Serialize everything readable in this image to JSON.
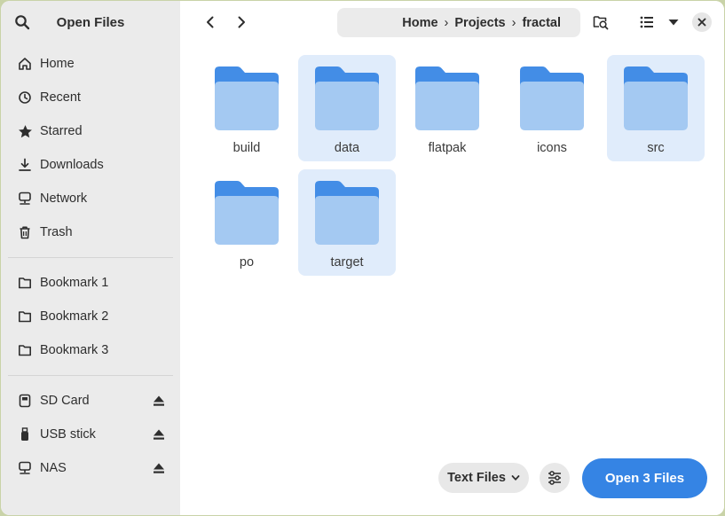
{
  "sidebar": {
    "title": "Open Files",
    "places": [
      {
        "label": "Home",
        "icon": "home-icon"
      },
      {
        "label": "Recent",
        "icon": "clock-icon"
      },
      {
        "label": "Starred",
        "icon": "star-icon"
      },
      {
        "label": "Downloads",
        "icon": "download-icon"
      },
      {
        "label": "Network",
        "icon": "network-icon"
      },
      {
        "label": "Trash",
        "icon": "trash-icon"
      }
    ],
    "bookmarks": [
      {
        "label": "Bookmark 1",
        "icon": "folder-icon"
      },
      {
        "label": "Bookmark 2",
        "icon": "folder-icon"
      },
      {
        "label": "Bookmark 3",
        "icon": "folder-icon"
      }
    ],
    "devices": [
      {
        "label": "SD Card",
        "icon": "sd-card-icon"
      },
      {
        "label": "USB stick",
        "icon": "usb-icon"
      },
      {
        "label": "NAS",
        "icon": "nas-icon"
      }
    ]
  },
  "path": {
    "crumbs": [
      "Home",
      "Projects",
      "fractal"
    ],
    "separator": "›"
  },
  "files": [
    {
      "name": "build",
      "selected": false
    },
    {
      "name": "data",
      "selected": true
    },
    {
      "name": "flatpak",
      "selected": false
    },
    {
      "name": "icons",
      "selected": false
    },
    {
      "name": "src",
      "selected": true
    },
    {
      "name": "po",
      "selected": false
    },
    {
      "name": "target",
      "selected": true
    }
  ],
  "footer": {
    "filter_label": "Text Files",
    "open_label": "Open 3 Files"
  },
  "colors": {
    "accent": "#3584e4",
    "folder_back": "#438de6",
    "folder_front": "#a4c9f2",
    "selection": "#e0ecfb"
  }
}
